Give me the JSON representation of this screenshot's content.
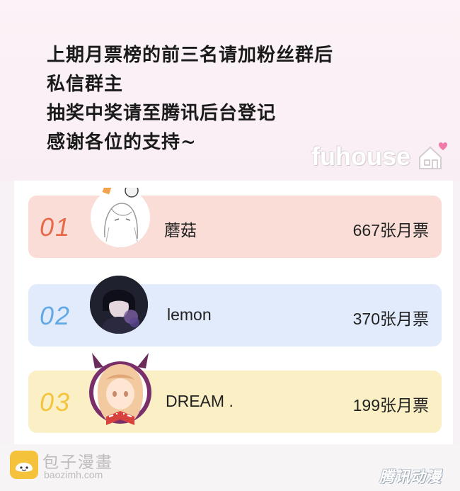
{
  "notice": {
    "line1": "上期月票榜的前三名请加粉丝群后",
    "line2": "私信群主",
    "line3": "抽奖中奖请至腾讯后台登记",
    "line4": "感谢各位的支持~"
  },
  "watermark": {
    "text": "fuhouse"
  },
  "ranking": [
    {
      "rank": "01",
      "name": "蘑菇",
      "votes": "667张月票",
      "color": "#f9ddd6"
    },
    {
      "rank": "02",
      "name": "lemon",
      "votes": "370张月票",
      "color": "#e1ebfb"
    },
    {
      "rank": "03",
      "name": "DREAM .",
      "votes": "199张月票",
      "color": "#fbefc6"
    }
  ],
  "footer": {
    "brand_name": "包子漫畫",
    "brand_url": "baozimh.com",
    "right_logo": "腾讯动漫"
  }
}
